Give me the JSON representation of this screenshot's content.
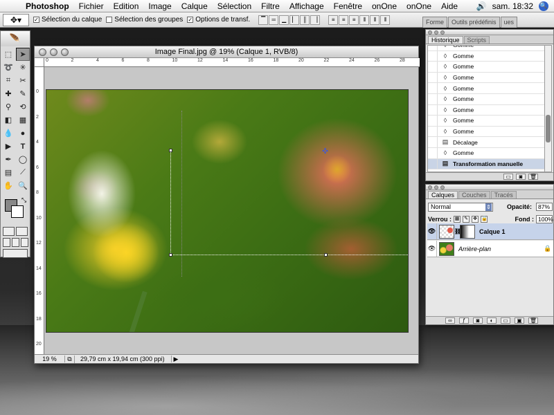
{
  "menubar": {
    "app": "Photoshop",
    "items": [
      "Fichier",
      "Edition",
      "Image",
      "Calque",
      "Sélection",
      "Filtre",
      "Affichage",
      "Fenêtre",
      "onOne",
      "onOne",
      "Aide"
    ],
    "clock": "sam. 18:32"
  },
  "options_bar": {
    "auto_select_layer": "Sélection du calque",
    "auto_select_groups": "Sélection des groupes",
    "transform_options": "Options de transf.",
    "well_tabs": [
      "Forme",
      "Outils prédéfinis",
      "ues"
    ]
  },
  "document": {
    "title": "Image Final.jpg @ 19% (Calque 1, RVB/8)",
    "ruler_h": [
      "0",
      "2",
      "4",
      "6",
      "8",
      "10",
      "12",
      "14",
      "16",
      "18",
      "20",
      "22",
      "24",
      "26",
      "28"
    ],
    "ruler_v": [
      "0",
      "2",
      "4",
      "6",
      "8",
      "10",
      "12",
      "14",
      "16",
      "18",
      "20"
    ],
    "zoom": "19 %",
    "size_info": "29,79 cm x 19,94 cm (300 ppi)"
  },
  "history_panel": {
    "tabs": [
      "Historique",
      "Scripts"
    ],
    "items": [
      {
        "label": "Gomme"
      },
      {
        "label": "Gomme"
      },
      {
        "label": "Gomme"
      },
      {
        "label": "Gomme"
      },
      {
        "label": "Gomme"
      },
      {
        "label": "Gomme"
      },
      {
        "label": "Gomme"
      },
      {
        "label": "Gomme"
      },
      {
        "label": "Gomme"
      },
      {
        "label": "Décalage"
      },
      {
        "label": "Gomme"
      },
      {
        "label": "Transformation manuelle"
      }
    ],
    "active_index": 11
  },
  "layers_panel": {
    "tabs": [
      "Calques",
      "Couches",
      "Tracés"
    ],
    "blend_mode": "Normal",
    "opacity_label": "Opacité:",
    "opacity_value": "87%",
    "lock_label": "Verrou :",
    "fill_label": "Fond :",
    "fill_value": "100%",
    "layers": [
      {
        "name": "Calque 1",
        "active": true
      },
      {
        "name": "Arrière-plan",
        "active": false
      }
    ]
  }
}
